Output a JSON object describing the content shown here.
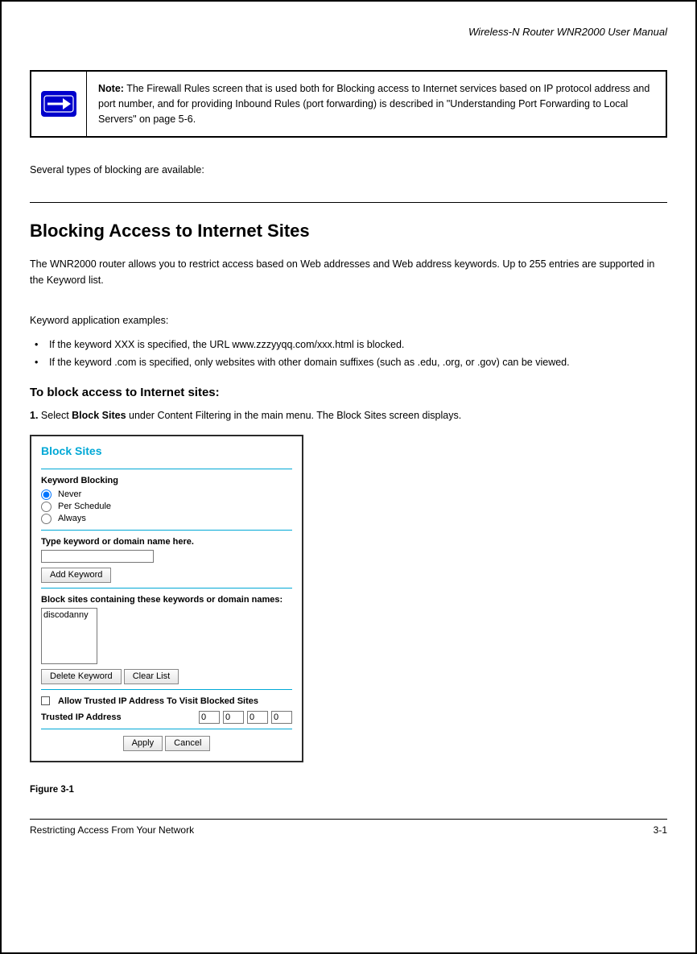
{
  "header": {
    "book_title": "Wireless-N Router WNR2000 User Manual"
  },
  "note": {
    "label": "Note:",
    "text": "The Firewall Rules screen that is used both for Blocking access to Internet services based on IP protocol address and port number, and for providing Inbound Rules (port forwarding) is described in \"Understanding Port Forwarding to Local Servers\" on page 5-6."
  },
  "intro": "Several types of blocking are available:",
  "section": {
    "title": "Blocking Access to Internet Sites",
    "p1": "The WNR2000 router allows you to restrict access based on Web addresses and Web address keywords. Up to 255 entries are supported in the Keyword list.",
    "p2": "Keyword application examples:",
    "bullets": [
      "If the keyword XXX is specified, the URL www.zzzyyqq.com/xxx.html is blocked.",
      "If the keyword .com is specified, only websites with other domain suffixes (such as .edu, .org, or .gov) can be viewed."
    ],
    "subheading": "To block access to Internet sites:",
    "step1_prefix": "1.",
    "step1_a": "Select ",
    "step1_b": "Block Sites",
    "step1_c": " under Content Filtering in the main menu. The Block Sites screen displays."
  },
  "panel": {
    "title": "Block Sites",
    "kw_blocking_label": "Keyword Blocking",
    "radios": {
      "never": "Never",
      "per_schedule": "Per Schedule",
      "always": "Always"
    },
    "type_kw_label": "Type keyword or domain name here.",
    "kw_input_value": "",
    "add_keyword_btn": "Add Keyword",
    "block_list_label": "Block sites containing these keywords or domain names:",
    "list_item": "discodanny",
    "delete_keyword_btn": "Delete Keyword",
    "clear_list_btn": "Clear List",
    "allow_trusted_label": "Allow Trusted IP Address To Visit Blocked Sites",
    "trusted_ip_label": "Trusted IP Address",
    "ip": {
      "a": "0",
      "b": "0",
      "c": "0",
      "d": "0"
    },
    "apply_btn": "Apply",
    "cancel_btn": "Cancel"
  },
  "figure_caption": "Figure 3-1",
  "footer": {
    "left": "Restricting Access From Your Network",
    "right": "3-1"
  }
}
